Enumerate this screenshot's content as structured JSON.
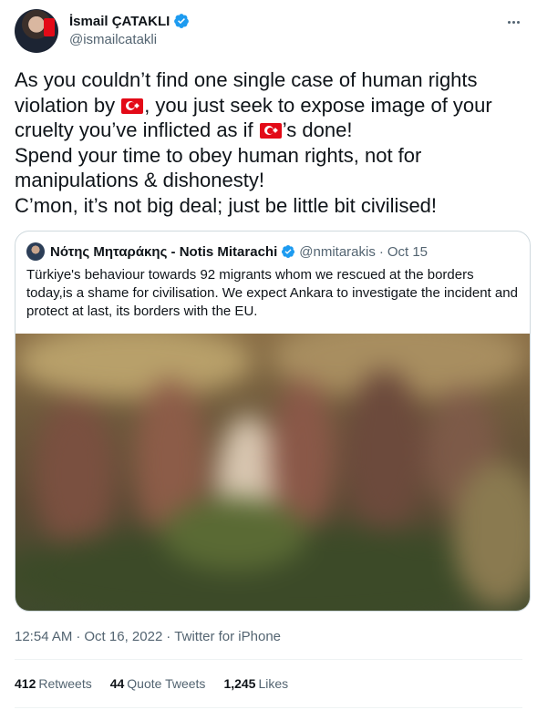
{
  "author": {
    "display_name": "İsmail ÇATAKLI",
    "handle": "@ismailcatakli",
    "verified": true
  },
  "tweet": {
    "lines": [
      {
        "before": "As you couldn’t find one single case of human rights",
        "after": ""
      },
      {
        "before": "violation by ",
        "flag": "turkey-flag-icon",
        "after": ", you just seek to expose image of your"
      },
      {
        "before": "cruelty you’ve inflicted as if ",
        "flag": "turkey-flag-icon",
        "after": "’s done!"
      },
      {
        "before": "Spend your time to obey human rights, not for",
        "after": ""
      },
      {
        "before": "manipulations & dishonesty!",
        "after": ""
      },
      {
        "before": "C’mon, it’s not big deal; just be little bit civilised!",
        "after": ""
      }
    ]
  },
  "quoted_tweet": {
    "display_name": "Νότης Μηταράκης - Notis Mitarachi",
    "handle": "@nmitarakis",
    "separator": "·",
    "date": "Oct 15",
    "text": "Türkiye's behaviour towards 92 migrants whom we rescued at the borders today,is a shame for civilisation. We expect Ankara to investigate the incident and protect at last, its borders with the EU."
  },
  "meta": {
    "time": "12:54 AM",
    "separator": "·",
    "date": "Oct 16, 2022",
    "source": "Twitter for iPhone"
  },
  "stats": {
    "retweets_count": "412",
    "retweets_label": "Retweets",
    "quotes_count": "44",
    "quotes_label": "Quote Tweets",
    "likes_count": "1,245",
    "likes_label": "Likes"
  },
  "colors": {
    "verified_blue": "#1d9bf0",
    "text_primary": "#0f1419",
    "text_secondary": "#536471",
    "turkey_red": "#e30a17"
  }
}
